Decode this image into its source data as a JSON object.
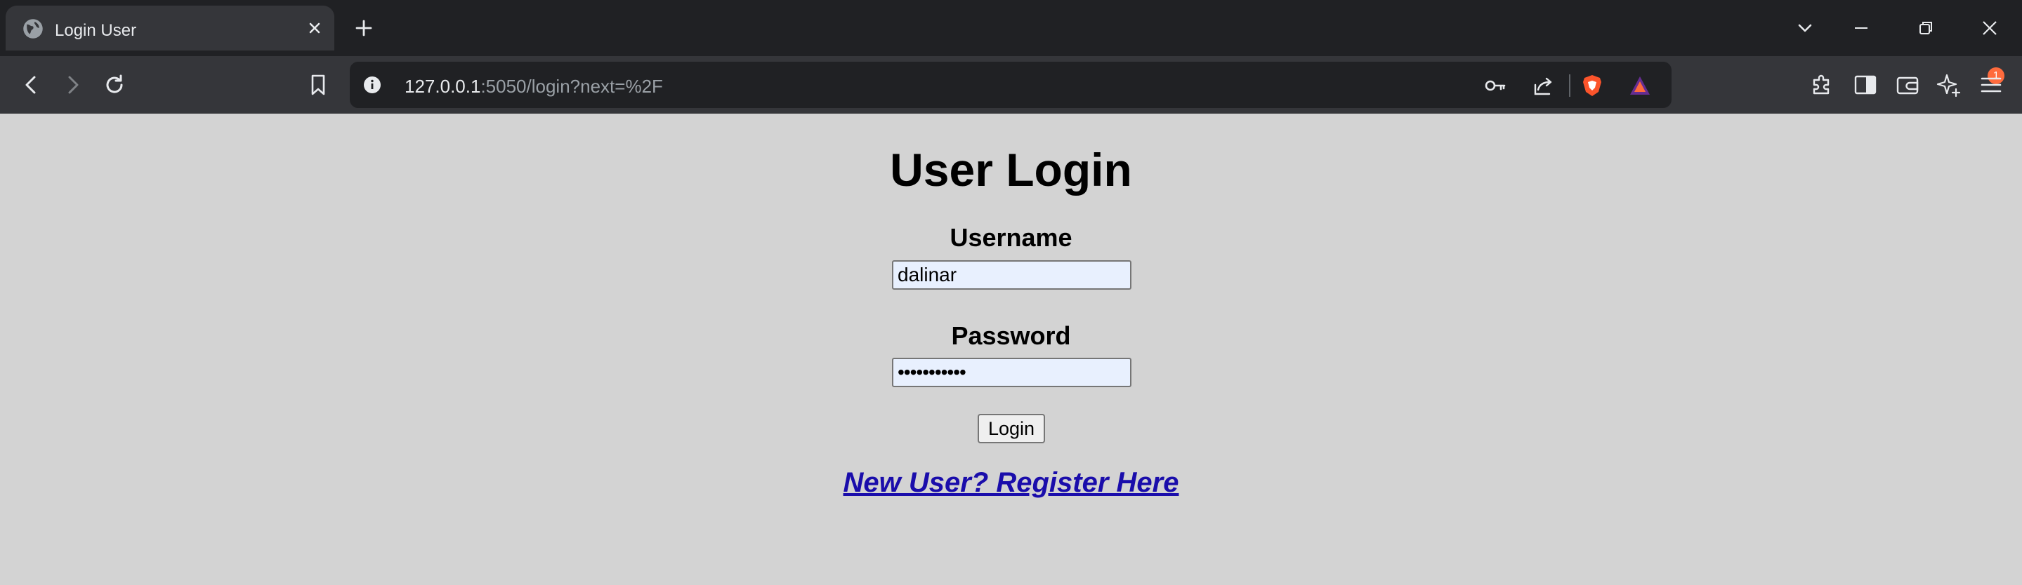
{
  "browser": {
    "tab": {
      "title": "Login User"
    },
    "address": {
      "host": "127.0.0.1",
      "path": ":5050/login?next=%2F"
    },
    "rewards_badge": "1"
  },
  "page": {
    "heading": "User Login",
    "username": {
      "label": "Username",
      "value": "dalinar"
    },
    "password": {
      "label": "Password",
      "masked_value": "•••••••••••"
    },
    "login_button": "Login",
    "register_link": "New User? Register Here"
  }
}
